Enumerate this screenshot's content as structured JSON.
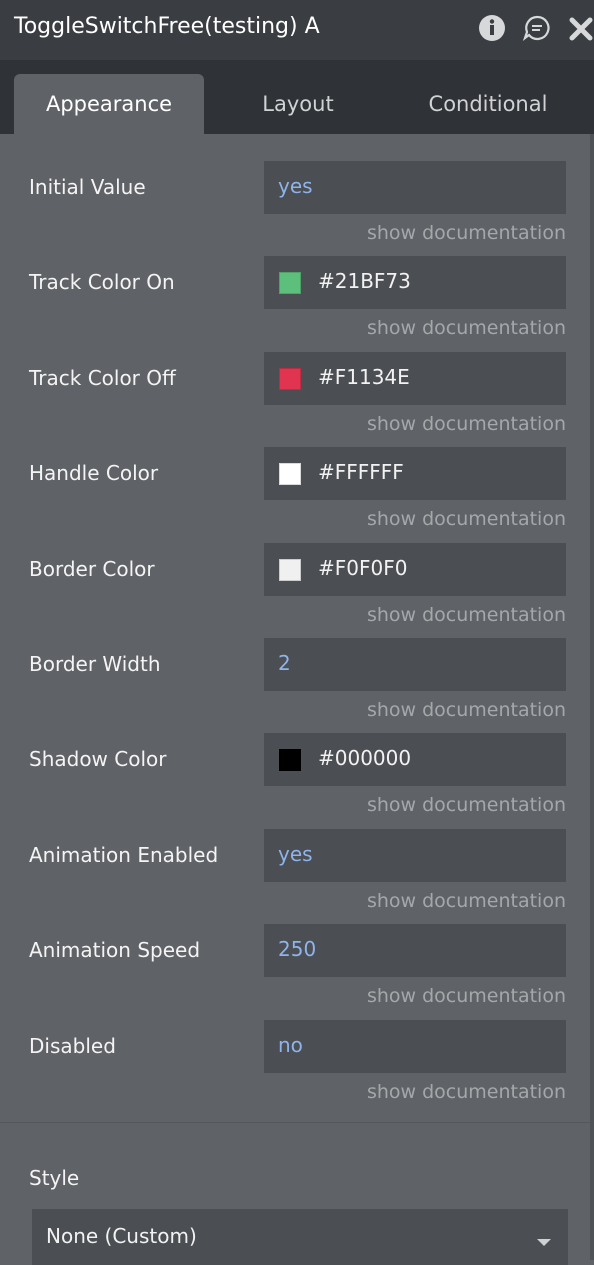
{
  "header": {
    "title": "ToggleSwitchFree(testing) A",
    "icons": [
      "info-icon",
      "comment-icon",
      "close-icon"
    ]
  },
  "tabs": [
    {
      "label": "Appearance",
      "active": true
    },
    {
      "label": "Layout",
      "active": false
    },
    {
      "label": "Conditional",
      "active": false
    }
  ],
  "properties": [
    {
      "label": "Initial Value",
      "value": "yes",
      "type": "text"
    },
    {
      "label": "Track Color On",
      "value": "#21BF73",
      "type": "color",
      "color": "#5cbf7b"
    },
    {
      "label": "Track Color Off",
      "value": "#F1134E",
      "type": "color",
      "color": "#e03450"
    },
    {
      "label": "Handle Color",
      "value": "#FFFFFF",
      "type": "color",
      "color": "#FFFFFF"
    },
    {
      "label": "Border Color",
      "value": "#F0F0F0",
      "type": "color",
      "color": "#F0F0F0"
    },
    {
      "label": "Border Width",
      "value": "2",
      "type": "text"
    },
    {
      "label": "Shadow Color",
      "value": "#000000",
      "type": "color",
      "color": "#000000"
    },
    {
      "label": "Animation Enabled",
      "value": "yes",
      "type": "text"
    },
    {
      "label": "Animation Speed",
      "value": "250",
      "type": "text"
    },
    {
      "label": "Disabled",
      "value": "no",
      "type": "text"
    }
  ],
  "doc_link": "show documentation",
  "style": {
    "label": "Style",
    "value": "None (Custom)"
  },
  "colors": {
    "panel_bg": "#5f6266",
    "titlebar_bg": "#3a3d41",
    "tabbar_bg": "#2f3236",
    "field_bg": "#4b4e52",
    "value_text": "#8fb3ea",
    "doc_text": "#a5a8ab"
  }
}
